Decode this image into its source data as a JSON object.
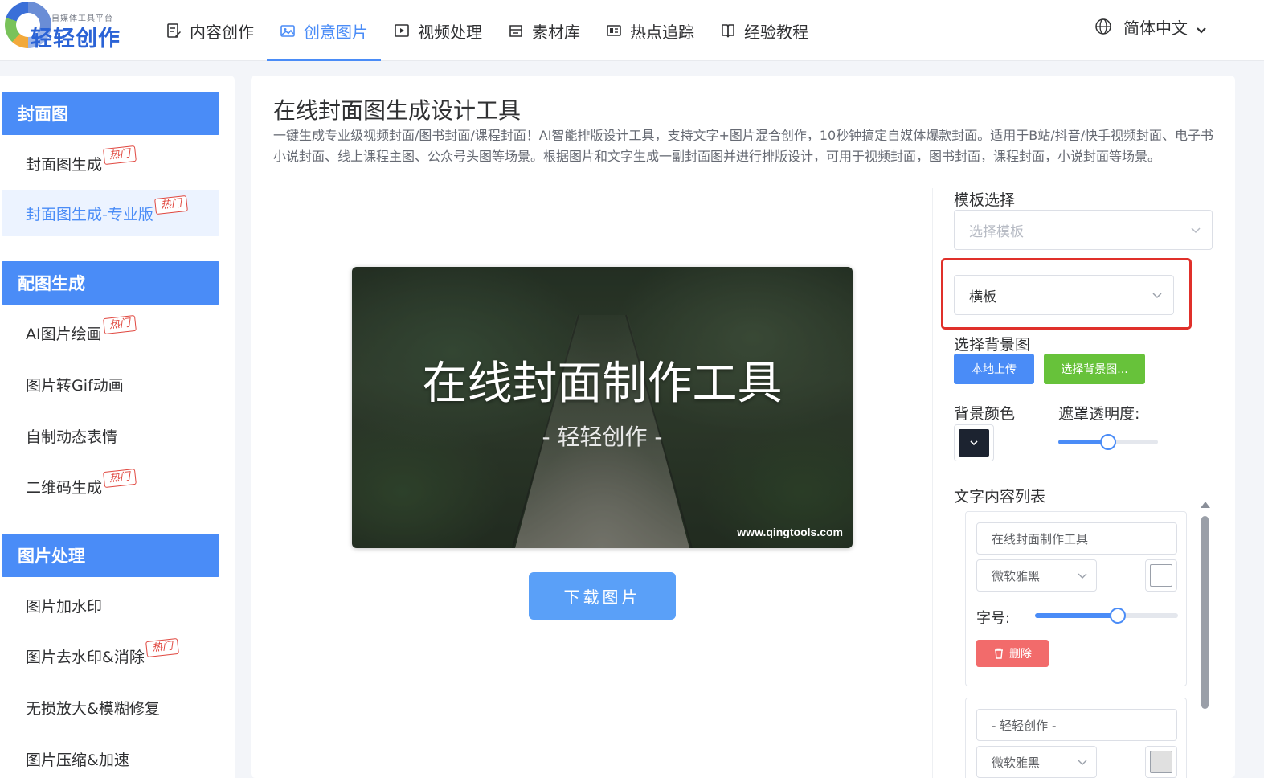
{
  "brand": {
    "name": "轻轻创作",
    "tagline": "自媒体工具平台"
  },
  "nav": {
    "items": [
      {
        "label": "内容创作",
        "icon": "edit-doc-icon"
      },
      {
        "label": "创意图片",
        "icon": "image-icon",
        "active": true
      },
      {
        "label": "视频处理",
        "icon": "video-icon"
      },
      {
        "label": "素材库",
        "icon": "archive-icon"
      },
      {
        "label": "热点追踪",
        "icon": "news-icon"
      },
      {
        "label": "经验教程",
        "icon": "book-icon"
      }
    ],
    "language": "简体中文"
  },
  "sidebar": {
    "groups": [
      {
        "title": "封面图",
        "items": [
          {
            "label": "封面图生成",
            "hot": "热门"
          },
          {
            "label": "封面图生成-专业版",
            "hot": "热门",
            "active": true
          }
        ]
      },
      {
        "title": "配图生成",
        "items": [
          {
            "label": "AI图片绘画",
            "hot": "热门"
          },
          {
            "label": "图片转Gif动画"
          },
          {
            "label": "自制动态表情"
          },
          {
            "label": "二维码生成",
            "hot": "热门"
          }
        ]
      },
      {
        "title": "图片处理",
        "items": [
          {
            "label": "图片加水印"
          },
          {
            "label": "图片去水印&消除",
            "hot": "热门"
          },
          {
            "label": "无损放大&模糊修复"
          },
          {
            "label": "图片压缩&加速"
          }
        ]
      }
    ]
  },
  "main": {
    "title": "在线封面图生成设计工具",
    "description": "一键生成专业级视频封面/图书封面/课程封面！AI智能排版设计工具，支持文字+图片混合创作，10秒钟搞定自媒体爆款封面。适用于B站/抖音/快手视频封面、电子书小说封面、线上课程主图、公众号头图等场景。根据图片和文字生成一副封面图并进行排版设计，可用于视频封面，图书封面，课程封面，小说封面等场景。",
    "cover": {
      "title": "在线封面制作工具",
      "subtitle": "- 轻轻创作 -",
      "watermark": "www.qingtools.com"
    },
    "download_label": "下载图片"
  },
  "settings": {
    "template_label": "模板选择",
    "template_placeholder": "选择模板",
    "orientation_value": "横板",
    "bg_image_label": "选择背景图",
    "upload_label": "本地上传",
    "choose_bg_label": "选择背景图...",
    "bg_color_label": "背景颜色",
    "bg_color": "#1c2330",
    "mask_opacity_label": "遮罩透明度:",
    "mask_opacity": 0.5,
    "text_list_label": "文字内容列表",
    "text_items": [
      {
        "text": "在线封面制作工具",
        "font": "微软雅黑",
        "size_label": "字号:",
        "size_level": 0.58,
        "delete_label": "删除",
        "color": "#ffffff"
      },
      {
        "text": "- 轻轻创作 -",
        "font": "微软雅黑",
        "color": "#e0e0e0"
      }
    ]
  }
}
